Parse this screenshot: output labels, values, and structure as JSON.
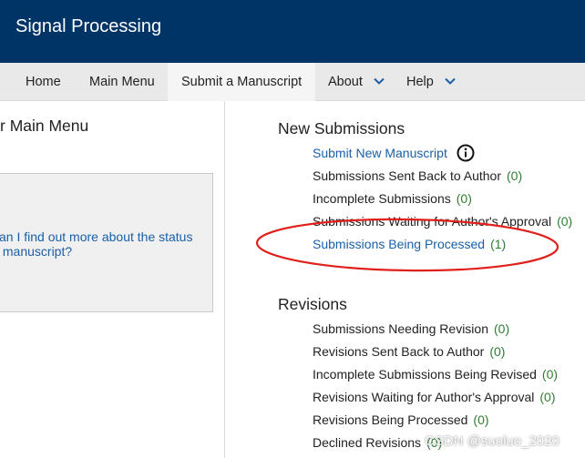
{
  "header": {
    "title": "Signal Processing"
  },
  "nav": {
    "home": "Home",
    "main_menu": "Main Menu",
    "submit": "Submit a Manuscript",
    "about": "About",
    "help": "Help"
  },
  "left": {
    "title": "r Main Menu",
    "faq_link": "an I find out more about the status\n manuscript?"
  },
  "new_submissions": {
    "title": "New Submissions",
    "submit_new": "Submit New Manuscript",
    "items": [
      {
        "label": "Submissions Sent Back to Author",
        "count": "(0)"
      },
      {
        "label": "Incomplete Submissions",
        "count": "(0)"
      },
      {
        "label": "Submissions Waiting for Author's Approval",
        "count": "(0)"
      },
      {
        "label": "Submissions Being Processed",
        "count": "(1)"
      }
    ]
  },
  "revisions": {
    "title": "Revisions",
    "items": [
      {
        "label": "Submissions Needing Revision",
        "count": "(0)"
      },
      {
        "label": "Revisions Sent Back to Author",
        "count": "(0)"
      },
      {
        "label": "Incomplete Submissions Being Revised",
        "count": "(0)"
      },
      {
        "label": "Revisions Waiting for Author's Approval",
        "count": "(0)"
      },
      {
        "label": "Revisions Being Processed",
        "count": "(0)"
      },
      {
        "label": "Declined Revisions",
        "count": "(0)"
      }
    ]
  },
  "watermark": "CSDN @suoluo_2020",
  "colors": {
    "header_bg": "#003366",
    "link": "#1a5fa8",
    "count": "#2e7d32",
    "annotation": "#e0201a"
  }
}
